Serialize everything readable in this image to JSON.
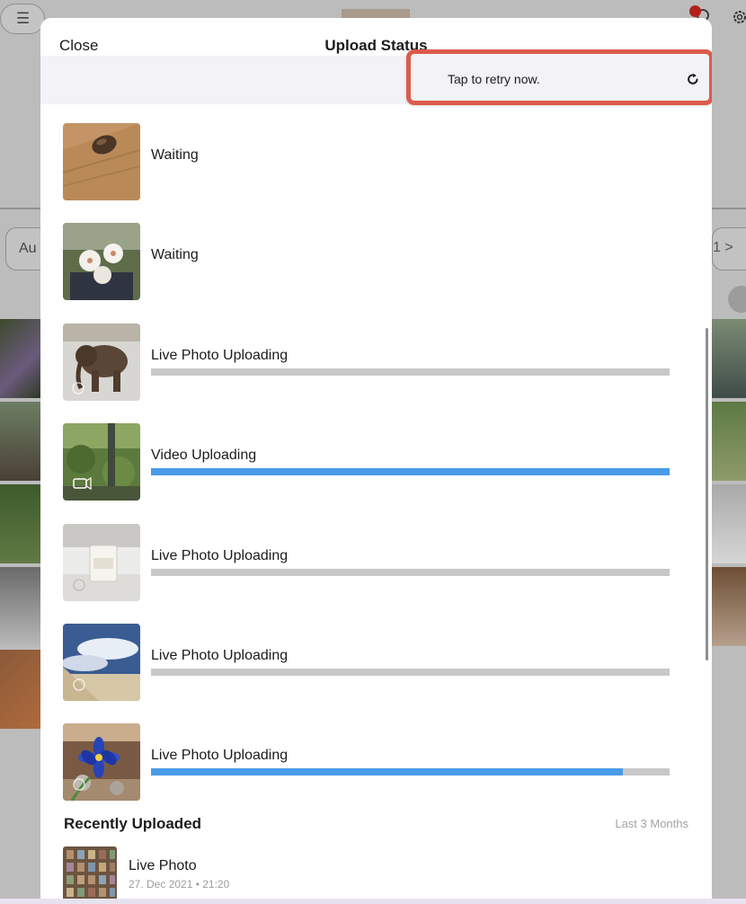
{
  "background": {
    "menu_label": "☰",
    "filter_label": "Au",
    "filter_right_label": "1 >"
  },
  "sheet": {
    "close_label": "Close",
    "title": "Upload Status",
    "retry_text": "Tap to retry now.",
    "retry_icon": "refresh-icon"
  },
  "uploads": [
    {
      "status": "Waiting",
      "thumb": "stone-on-wood",
      "progress": null
    },
    {
      "status": "Waiting",
      "thumb": "white-orchids",
      "progress": null
    },
    {
      "status": "Live Photo Uploading",
      "thumb": "elephant-figurine",
      "badge": "live-photo-icon",
      "progress": 0.0
    },
    {
      "status": "Video Uploading",
      "thumb": "garden-view",
      "badge": "video-camera-icon",
      "progress": 1.0
    },
    {
      "status": "Live Photo Uploading",
      "thumb": "white-candle",
      "badge": "live-photo-icon",
      "progress": 0.0
    },
    {
      "status": "Live Photo Uploading",
      "thumb": "sky-clouds",
      "badge": "live-photo-icon",
      "progress": 0.0
    },
    {
      "status": "Live Photo Uploading",
      "thumb": "blue-flower",
      "badge": "live-photo-icon",
      "progress": 0.91
    }
  ],
  "recent": {
    "title": "Recently Uploaded",
    "range": "Last 3 Months",
    "items": [
      {
        "title": "Live Photo",
        "date": "27. Dec 2021 • 21:20"
      }
    ]
  },
  "colors": {
    "accent_progress": "#4a9be8",
    "progress_track": "#c8c8c8",
    "highlight_border": "#dc5b4c",
    "banner_bg": "#f2f2f7"
  }
}
